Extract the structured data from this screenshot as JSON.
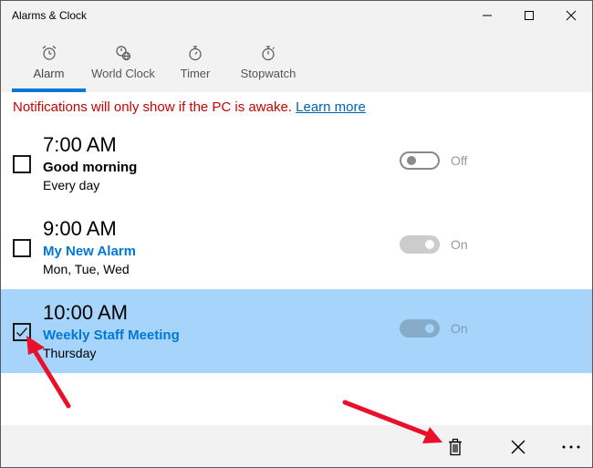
{
  "window": {
    "title": "Alarms & Clock"
  },
  "tabs": [
    {
      "label": "Alarm",
      "icon": "alarm-clock-icon"
    },
    {
      "label": "World Clock",
      "icon": "world-clock-icon"
    },
    {
      "label": "Timer",
      "icon": "timer-icon"
    },
    {
      "label": "Stopwatch",
      "icon": "stopwatch-icon"
    }
  ],
  "notice": {
    "text": "Notifications will only show if the PC is awake.",
    "link": "Learn more"
  },
  "alarms": [
    {
      "time": "7:00 AM",
      "name": "Good morning",
      "repeat": "Every day",
      "state": "Off",
      "checked": false,
      "selected": false
    },
    {
      "time": "9:00 AM",
      "name": "My New Alarm",
      "repeat": "Mon, Tue, Wed",
      "state": "On",
      "checked": false,
      "selected": false
    },
    {
      "time": "10:00 AM",
      "name": "Weekly Staff Meeting",
      "repeat": "Thursday",
      "state": "On",
      "checked": true,
      "selected": true
    }
  ],
  "colors": {
    "accent": "#0078d7",
    "selected_row": "#a6d4fa",
    "notice_red": "#c50500",
    "annotation_arrow": "#e8102a"
  },
  "bottom_bar": {
    "buttons": [
      "trash-icon",
      "close-icon",
      "more-icon"
    ]
  }
}
